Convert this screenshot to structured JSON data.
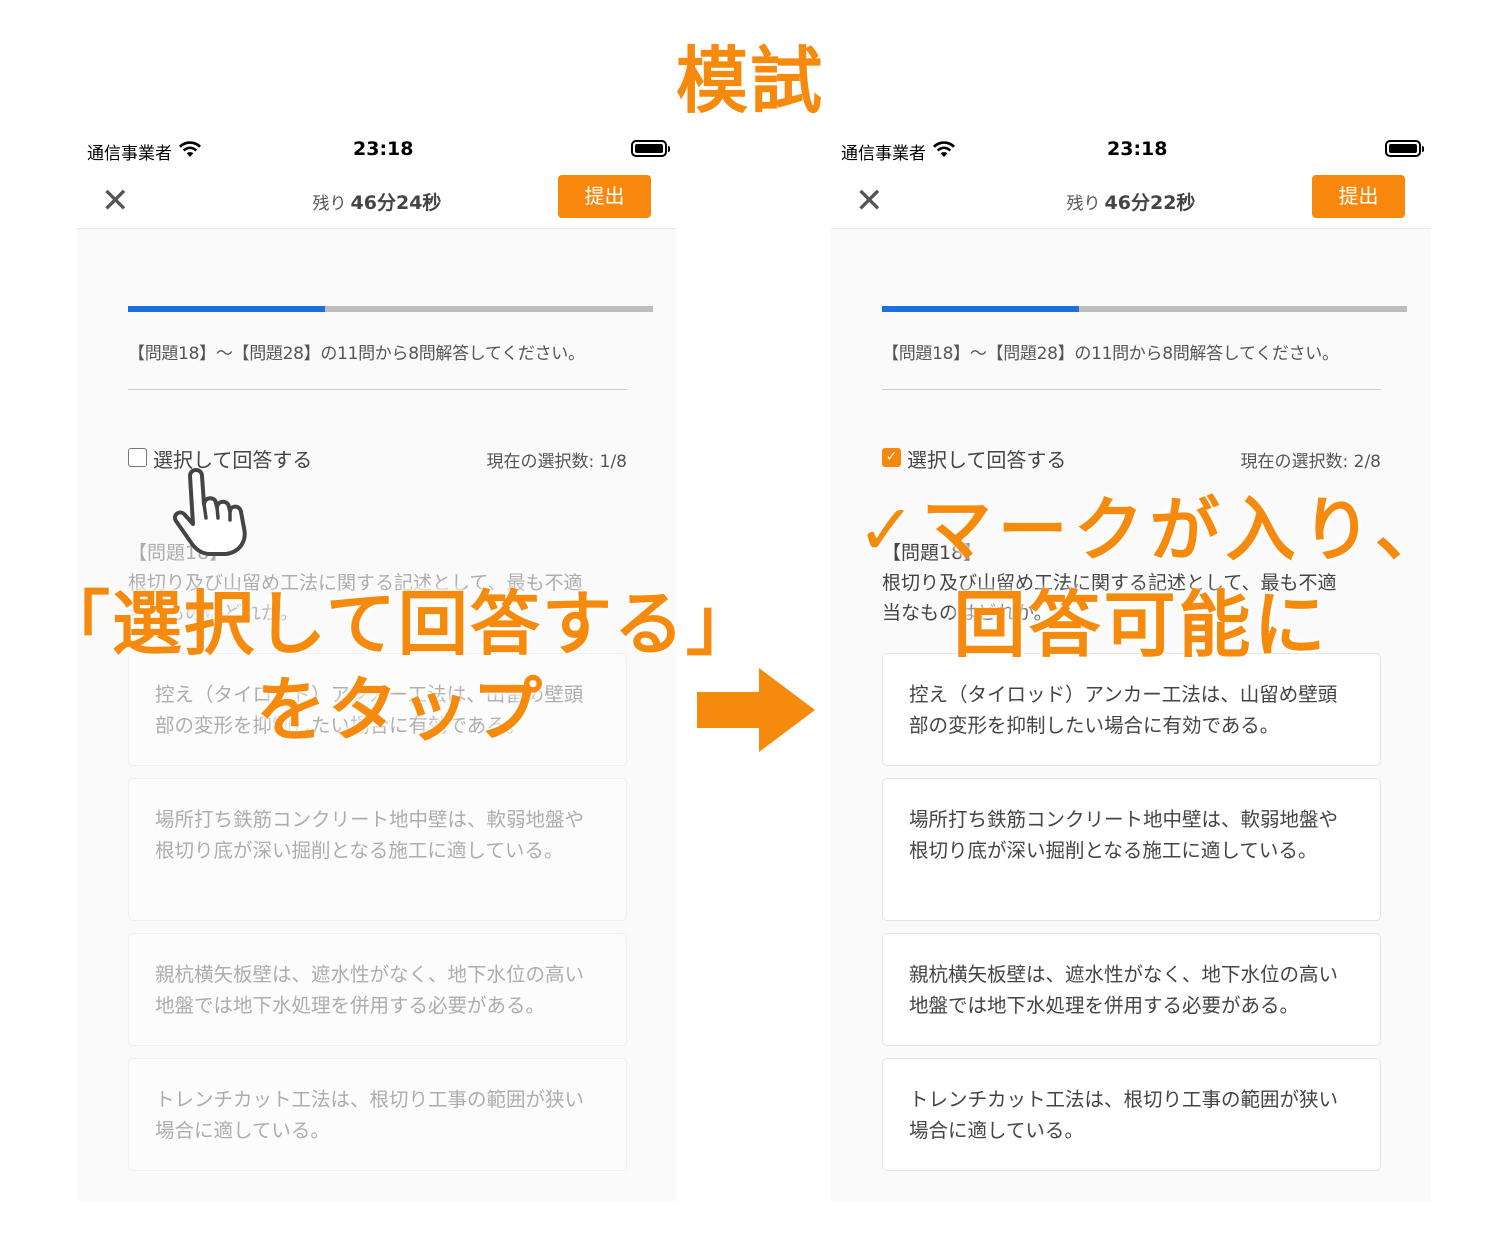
{
  "title": "模試",
  "accent_color": "#f58a0d",
  "progress_color": "#1d6fe0",
  "screens": [
    {
      "status": {
        "carrier": "通信事業者",
        "wifi_icon": "wifi-icon",
        "time": "23:18",
        "battery_icon": "battery-icon"
      },
      "nav": {
        "close": "✕",
        "timer_prefix": "残り",
        "timer_value": "46分24秒",
        "submit": "提出"
      },
      "progress": 0.375,
      "instruction": "【問題18】〜【問題28】の11問から8問解答してください。",
      "select_label": "選択して回答する",
      "select_checked": false,
      "select_count": "現在の選択数: 1/8",
      "question_number": "【問題18】",
      "question_text": "根切り及び山留め工法に関する記述として、最も不適当なものはどれか。",
      "choices": [
        "控え（タイロッド）アンカー工法は、山留め壁頭部の変形を抑制したい場合に有効である。",
        "場所打ち鉄筋コンクリート地中壁は、軟弱地盤や根切り底が深い掘削となる施工に適している。",
        "親杭横矢板壁は、遮水性がなく、地下水位の高い地盤では地下水処理を併用する必要がある。",
        "トレンチカット工法は、根切り工事の範囲が狭い場合に適している。"
      ]
    },
    {
      "status": {
        "carrier": "通信事業者",
        "wifi_icon": "wifi-icon",
        "time": "23:18",
        "battery_icon": "battery-icon"
      },
      "nav": {
        "close": "✕",
        "timer_prefix": "残り",
        "timer_value": "46分22秒",
        "submit": "提出"
      },
      "progress": 0.375,
      "instruction": "【問題18】〜【問題28】の11問から8問解答してください。",
      "select_label": "選択して回答する",
      "select_checked": true,
      "select_count": "現在の選択数: 2/8",
      "question_number": "【問題18】",
      "question_text": "根切り及び山留め工法に関する記述として、最も不適当なものはどれか。",
      "choices": [
        "控え（タイロッド）アンカー工法は、山留め壁頭部の変形を抑制したい場合に有効である。",
        "場所打ち鉄筋コンクリート地中壁は、軟弱地盤や根切り底が深い掘削となる施工に適している。",
        "親杭横矢板壁は、遮水性がなく、地下水位の高い地盤では地下水処理を併用する必要がある。",
        "トレンチカット工法は、根切り工事の範囲が狭い場合に適している。"
      ]
    }
  ],
  "annotations": {
    "left_line1": "「選択して回答する」",
    "left_line2": "をタップ",
    "right_line1": "✓マークが入り、",
    "right_line2": "回答可能に",
    "arrow_icon": "arrow-right-icon",
    "pointer_icon": "pointer-hand-icon"
  }
}
